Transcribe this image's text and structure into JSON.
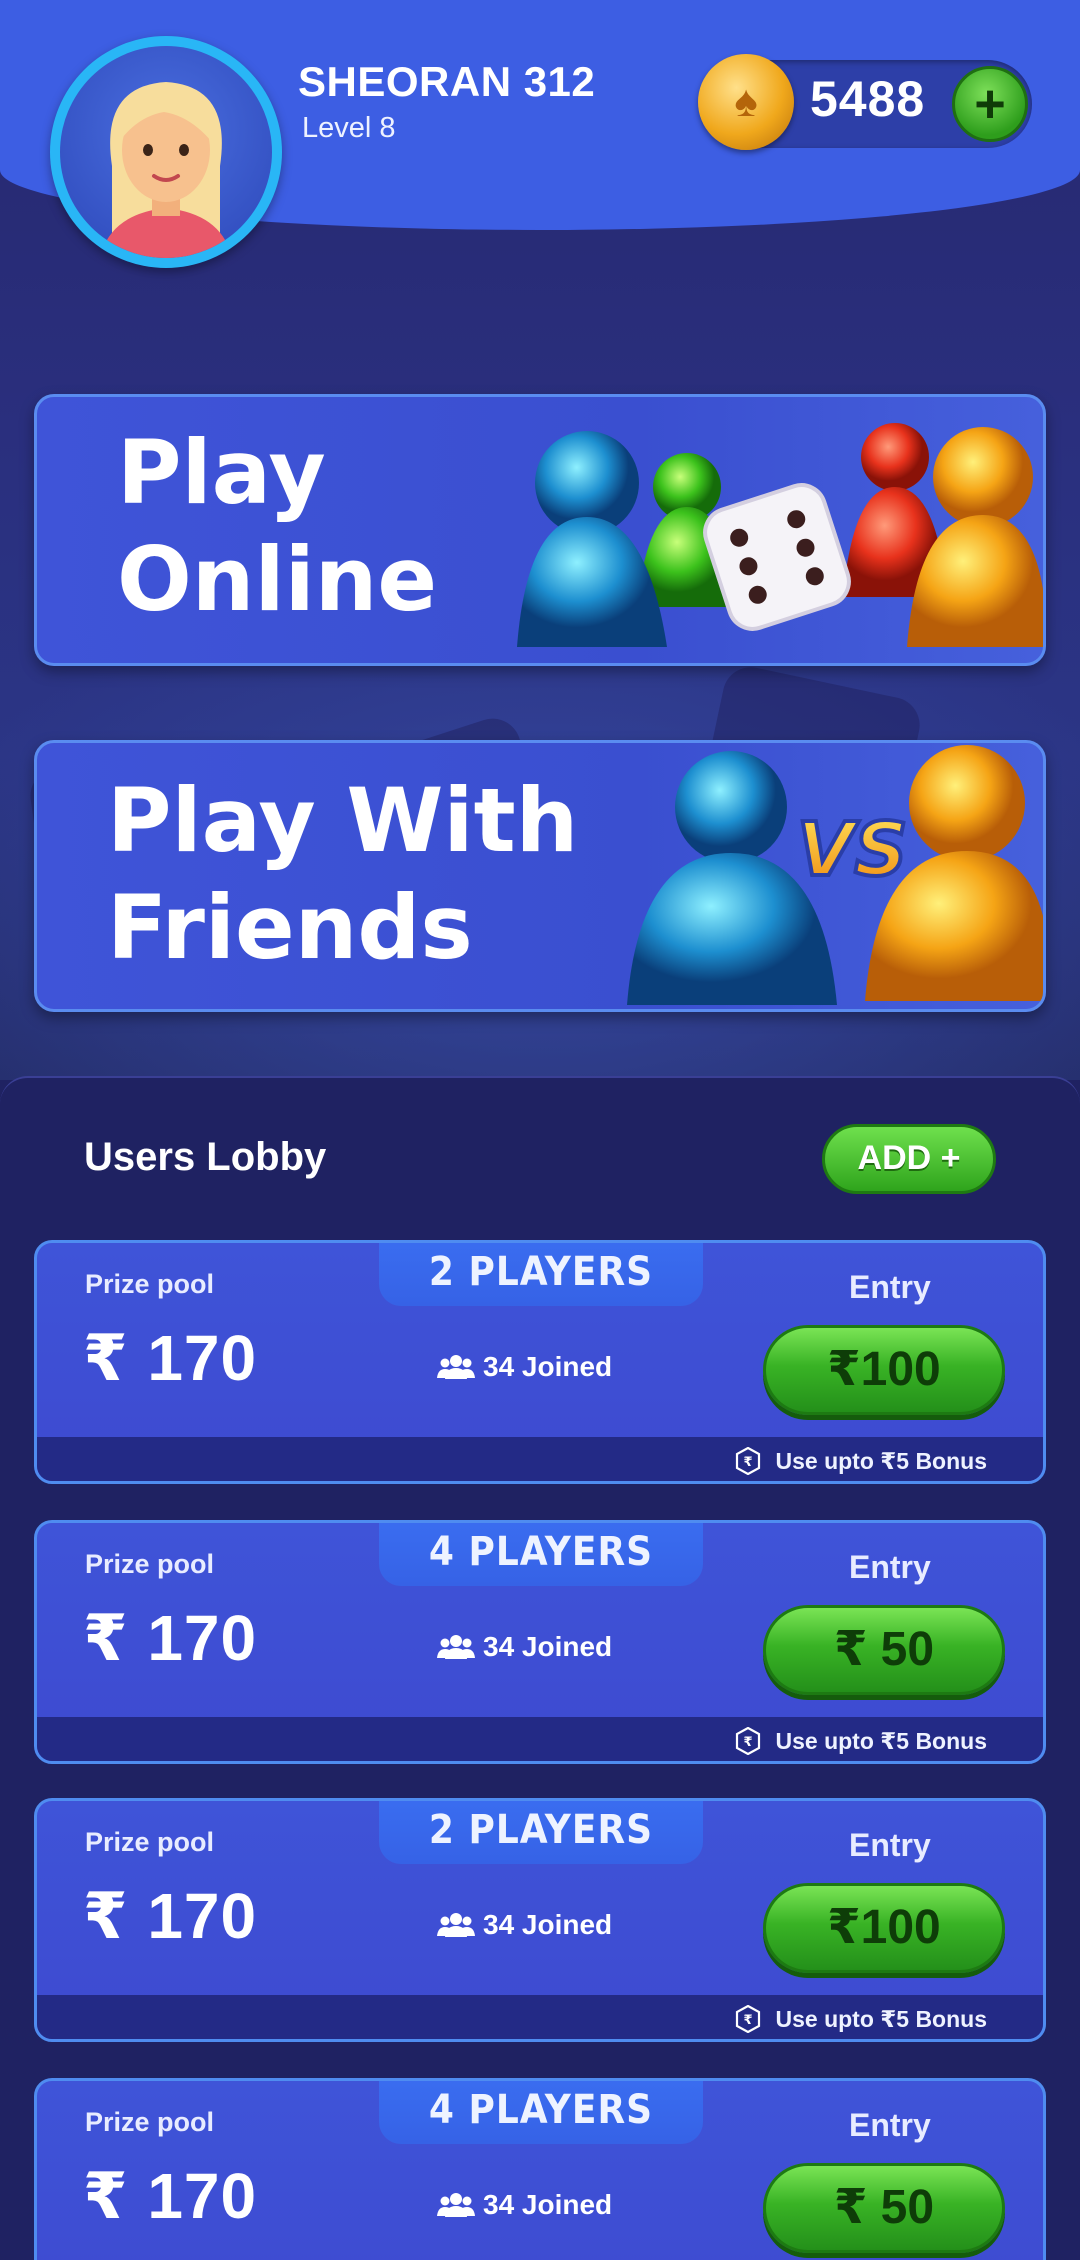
{
  "profile": {
    "username": "SHEORAN 312",
    "level": "Level 8"
  },
  "wallet": {
    "coins": "5488",
    "add_symbol": "+"
  },
  "modes": {
    "play_online": "Play Online",
    "play_online_line1": "Play",
    "play_online_line2": "Online",
    "play_friends_line1": "Play With",
    "play_friends_line2": "Friends",
    "vs_label": "VS"
  },
  "lobby": {
    "title": "Users Lobby",
    "add_label": "ADD +",
    "prize_label": "Prize pool",
    "entry_label": "Entry",
    "tables": [
      {
        "players": "2 PLAYERS",
        "prize": "₹ 170",
        "joined": "34 Joined",
        "entry": "₹100",
        "bonus": "Use upto ₹5 Bonus"
      },
      {
        "players": "4 PLAYERS",
        "prize": "₹ 170",
        "joined": "34 Joined",
        "entry": "₹ 50",
        "bonus": "Use upto ₹5 Bonus"
      },
      {
        "players": "2 PLAYERS",
        "prize": "₹ 170",
        "joined": "34 Joined",
        "entry": "₹100",
        "bonus": "Use upto ₹5 Bonus"
      },
      {
        "players": "4 PLAYERS",
        "prize": "₹ 170",
        "joined": "34 Joined",
        "entry": "₹ 50",
        "bonus": ""
      }
    ]
  },
  "colors": {
    "accent_blue": "#3d5ee3",
    "card_blue": "#3f54d8",
    "button_green": "#39b325",
    "background": "#1f2262"
  }
}
